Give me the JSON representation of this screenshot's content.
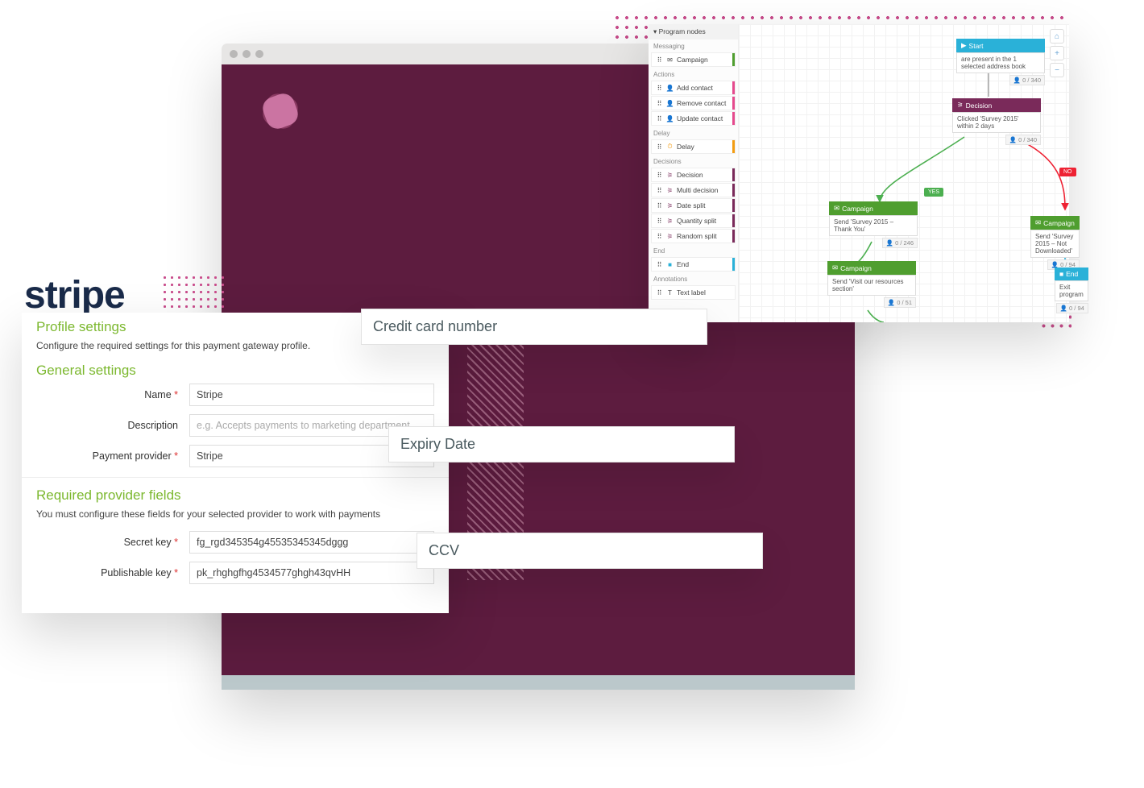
{
  "stripe_logo": "stripe",
  "settings": {
    "profile_title": "Profile settings",
    "profile_desc": "Configure the required settings for this payment gateway profile.",
    "general_title": "General settings",
    "name_label": "Name",
    "name_value": "Stripe",
    "description_label": "Description",
    "description_placeholder": "e.g. Accepts payments to marketing department",
    "provider_label": "Payment provider",
    "provider_value": "Stripe",
    "required_title": "Required provider fields",
    "required_desc": "You must configure these fields for your selected provider to work with payments",
    "secret_label": "Secret key",
    "secret_value": "fg_rgd345354g45535345345dggg",
    "publishable_label": "Publishable key",
    "publishable_value": "pk_rhghgfhg4534577ghgh43qvHH",
    "req": "*"
  },
  "cc": {
    "number_label": "Credit card number",
    "expiry_label": "Expiry Date",
    "ccv_label": "CCV"
  },
  "wf": {
    "panel_title": "Program nodes",
    "groups": {
      "messaging": "Messaging",
      "actions": "Actions",
      "delay": "Delay",
      "decisions": "Decisions",
      "end": "End",
      "annotations": "Annotations"
    },
    "items": {
      "campaign": "Campaign",
      "add_contact": "Add contact",
      "remove_contact": "Remove contact",
      "update_contact": "Update contact",
      "delay": "Delay",
      "decision": "Decision",
      "multi_decision": "Multi decision",
      "date_split": "Date split",
      "quantity_split": "Quantity split",
      "random_split": "Random split",
      "end": "End",
      "text_label": "Text label"
    },
    "nodes": {
      "start_title": "Start",
      "start_body": "are present in the 1 selected address book",
      "start_count": "0 / 340",
      "decision_title": "Decision",
      "decision_body": "Clicked 'Survey 2015' within 2 days",
      "decision_count": "0 / 340",
      "camp1_title": "Campaign",
      "camp1_body": "Send 'Survey 2015 – Thank You'",
      "camp1_count": "0 / 246",
      "camp2_title": "Campaign",
      "camp2_body": "Send 'Survey 2015 – Not Downloaded'",
      "camp2_count": "0 / 94",
      "camp3_title": "Campaign",
      "camp3_body": "Send 'Visit our resources section'",
      "camp3_count": "0 / 51",
      "end_title": "End",
      "end_body": "Exit program",
      "end_count": "0 / 94",
      "yes": "YES",
      "no": "NO"
    },
    "controls": {
      "plus": "+",
      "minus": "−",
      "home": "⌂"
    }
  },
  "colors": {
    "green": "#4f9e2f",
    "pink": "#e54a8d",
    "orange": "#f39c12",
    "purple": "#7a2a5a",
    "cyan": "#2ab1d8"
  }
}
